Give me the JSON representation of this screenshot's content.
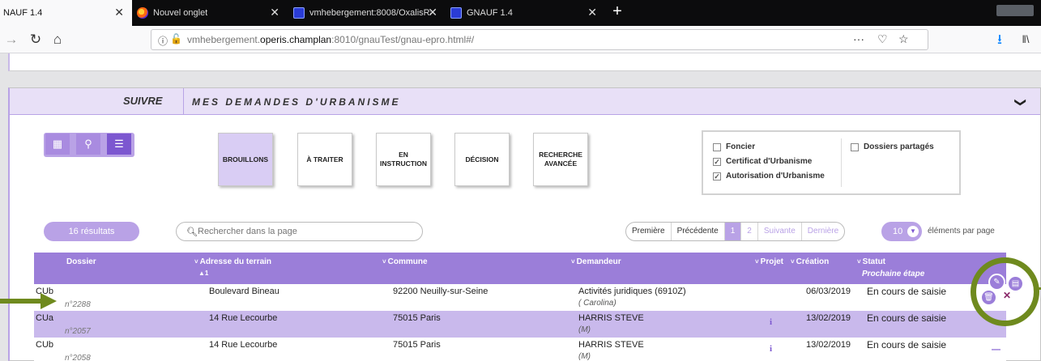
{
  "browser": {
    "tabs": [
      {
        "title": "NAUF 1.4",
        "close": "✕",
        "icon": "none",
        "active": true
      },
      {
        "title": "Nouvel onglet",
        "close": "✕",
        "icon": "firefox-icon",
        "active": false
      },
      {
        "title": "vmhebergement:8008/OxalisRa",
        "close": "✕",
        "icon": "opera-icon",
        "active": false
      },
      {
        "title": "GNAUF 1.4",
        "close": "✕",
        "icon": "opera-icon",
        "active": false
      }
    ],
    "new_tab": "+",
    "url_prefix": "vmhebergement.",
    "url_host": "operis.champlan",
    "url_suffix": ":8010/gnauTest/gnau-epro.html#/",
    "url_more": "···"
  },
  "header": {
    "section": "SUIVRE",
    "title": "MES DEMANDES D'URBANISME",
    "collapse": "❯"
  },
  "views": [
    {
      "name": "grid-icon",
      "glyph": "▦",
      "active": false
    },
    {
      "name": "map-pin-icon",
      "glyph": "⚲",
      "active": false
    },
    {
      "name": "list-icon",
      "glyph": "☰",
      "active": true
    }
  ],
  "categories": [
    {
      "label": "BROUILLONS",
      "active": true
    },
    {
      "label": "À TRAITER",
      "active": false
    },
    {
      "label": "EN\nINSTRUCTION",
      "active": false
    },
    {
      "label": "DÉCISION",
      "active": false
    },
    {
      "label": "RECHERCHE\nAVANCÉE",
      "active": false
    }
  ],
  "filters": {
    "foncier": {
      "label": "Foncier",
      "checked": false
    },
    "cu": {
      "label": "Certificat d'Urbanisme",
      "checked": true
    },
    "au": {
      "label": "Autorisation d'Urbanisme",
      "checked": true
    },
    "shared": {
      "label": "Dossiers partagés",
      "checked": false
    }
  },
  "results": "16 résultats",
  "search_placeholder": "Rechercher dans la page",
  "pagination": {
    "first": "Première",
    "prev": "Précédente",
    "pages": [
      "1",
      "2"
    ],
    "next": "Suivante",
    "last": "Dernière",
    "current": 1
  },
  "per_page": {
    "value": "10",
    "label": "éléments par page"
  },
  "table": {
    "headers": {
      "dossier": "Dossier",
      "adresse": "Adresse du terrain",
      "adresse_sort": "▲1",
      "commune": "Commune",
      "demandeur": "Demandeur",
      "projet": "Projet",
      "creation": "Création",
      "statut": "Statut",
      "prochaine": "Prochaine étape"
    },
    "rows": [
      {
        "type": "CUb",
        "num": "n°2288",
        "adresse": "Boulevard Bineau",
        "commune": "92200 Neuilly-sur-Seine",
        "demandeur": "Activités juridiques (6910Z)",
        "demandeur2": "(                        Carolina)",
        "creation": "06/03/2019",
        "statut": "En cours de saisie",
        "info": ""
      },
      {
        "type": "CUa",
        "num": "n°2057",
        "adresse": "14 Rue Lecourbe",
        "commune": "75015 Paris",
        "demandeur": "HARRIS STEVE",
        "demandeur2": "(M)",
        "creation": "13/02/2019",
        "statut": "En cours de saisie",
        "info": "i"
      },
      {
        "type": "CUb",
        "num": "n°2058",
        "adresse": "14 Rue Lecourbe",
        "commune": "75015 Paris",
        "demandeur": "HARRIS STEVE",
        "demandeur2": "(M)",
        "creation": "13/02/2019",
        "statut": "En cours de saisie",
        "info": "i"
      }
    ]
  },
  "row_actions": {
    "edit": "✎",
    "view": "▤",
    "delete": "🗑",
    "close": "✕",
    "more": "—"
  },
  "colors": {
    "accent": "#9b7ed9",
    "accent_light": "#d9cdf4",
    "highlight_ring": "#6f8a1e"
  }
}
